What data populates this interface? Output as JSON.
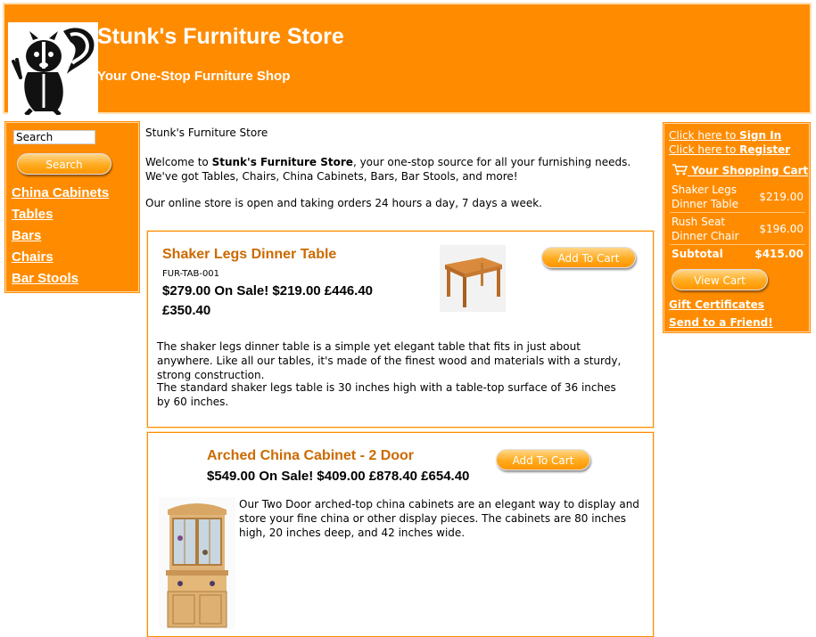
{
  "header": {
    "title": "Stunk's Furniture Store",
    "tagline": "Your One-Stop Furniture Shop"
  },
  "search": {
    "value": "Search",
    "button": "Search"
  },
  "categories": [
    "China Cabinets",
    "Tables",
    "Bars",
    "Chairs",
    "Bar Stools"
  ],
  "main": {
    "heading": "Stunk's Furniture Store",
    "welcome_pre": "Welcome to ",
    "welcome_bold": "Stunk's Furniture Store",
    "welcome_post": ", your one-stop source for all your furnishing needs. We've got Tables, Chairs, China Cabinets, Bars, Bar Stools, and more!",
    "hours": "Our online store is open and taking orders 24 hours a day, 7 days a week."
  },
  "products": [
    {
      "title": "Shaker Legs Dinner Table",
      "sku": "FUR-TAB-001",
      "price_line1": "$279.00 On Sale! $219.00 £446.40",
      "price_line2": "£350.40",
      "button": "Add To Cart",
      "desc1": "The shaker legs dinner table is a simple yet elegant table that fits in just about anywhere. Like all our tables, it's made of the finest wood and materials with a sturdy, strong construction.",
      "desc2": "The standard shaker legs table is 30 inches high with a table-top surface of 36 inches by 60 inches."
    },
    {
      "title": "Arched China Cabinet - 2 Door",
      "price_line1": "$549.00 On Sale! $409.00 £878.40 £654.40",
      "button": "Add To Cart",
      "desc1": "Our Two Door arched-top china cabinets are an elegant way to display and store your fine china or other display pieces. The cabinets are 80 inches high, 20 inches deep, and 42 inches wide."
    }
  ],
  "account": {
    "signin_pre": "Click here to ",
    "signin": "Sign In",
    "register_pre": "Click here to ",
    "register": "Register"
  },
  "cart": {
    "heading": "Your Shopping Cart",
    "items": [
      {
        "name": "Shaker Legs Dinner Table",
        "price": "$219.00"
      },
      {
        "name": "Rush Seat Dinner Chair",
        "price": "$196.00"
      }
    ],
    "subtotal_label": "Subtotal",
    "subtotal": "$415.00",
    "view_button": "View Cart",
    "gift": "Gift Certificates",
    "send": "Send to a Friend!"
  },
  "colors": {
    "brand": "#ff8c00",
    "title": "#cc6a00",
    "border_light": "#ffe0b0"
  },
  "icons": [
    "skunk-logo",
    "cart-icon"
  ]
}
